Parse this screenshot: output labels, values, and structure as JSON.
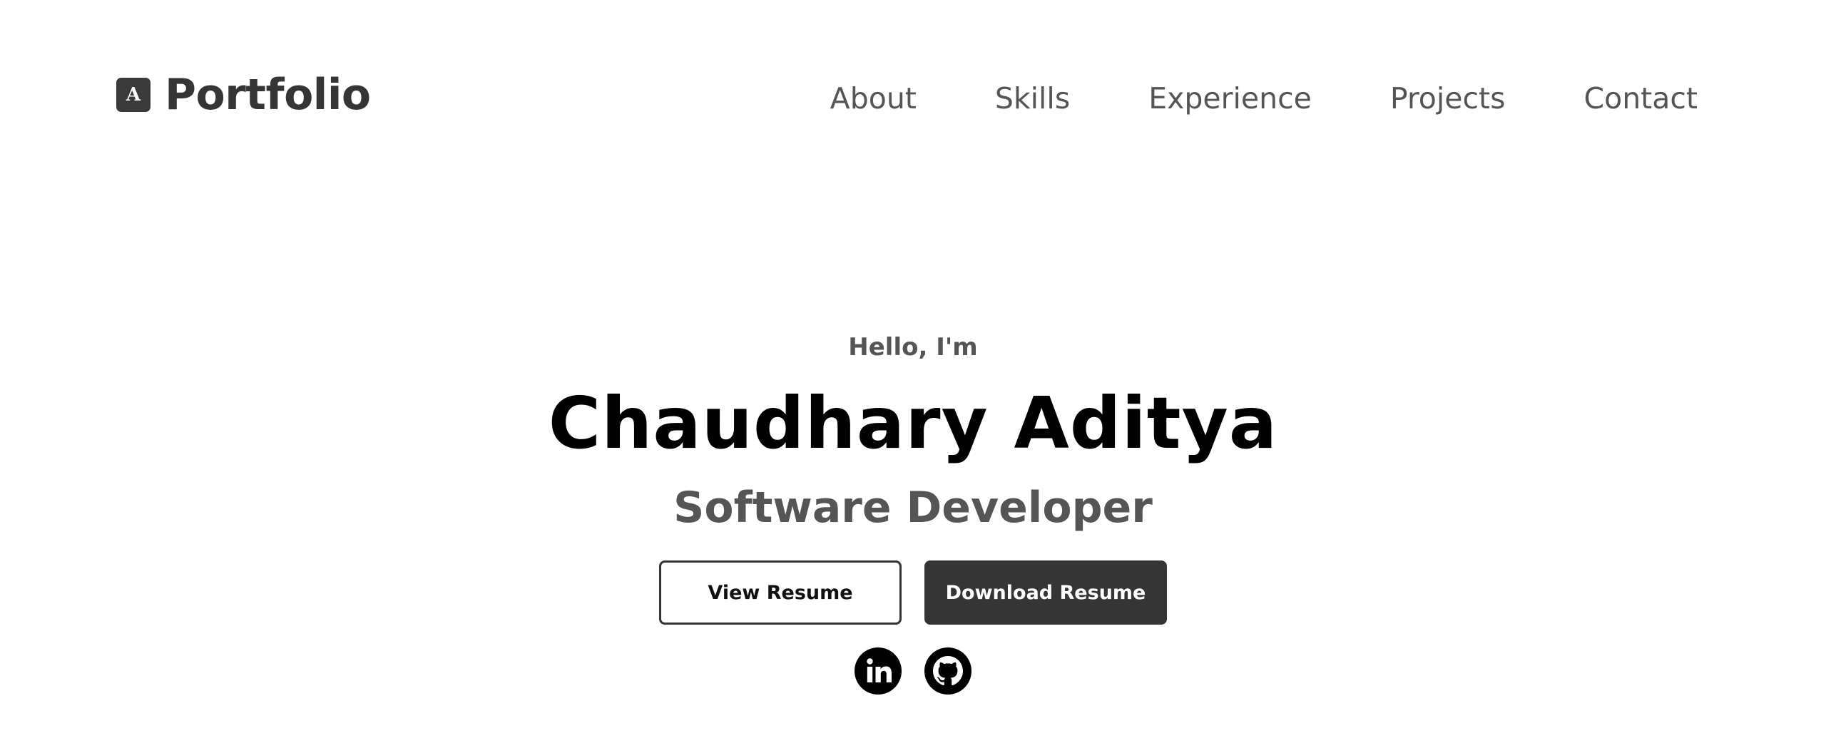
{
  "header": {
    "brand": {
      "logo_letter": "A",
      "name": "Portfolio"
    },
    "nav": [
      {
        "label": "About"
      },
      {
        "label": "Skills"
      },
      {
        "label": "Experience"
      },
      {
        "label": "Projects"
      },
      {
        "label": "Contact"
      }
    ]
  },
  "hero": {
    "greeting": "Hello, I'm",
    "name": "Chaudhary Aditya",
    "role": "Software Developer",
    "buttons": {
      "view_resume": "View Resume",
      "download_resume": "Download Resume"
    },
    "socials": [
      {
        "icon": "linkedin-icon"
      },
      {
        "icon": "github-icon"
      }
    ]
  },
  "colors": {
    "background": "#ffffff",
    "primary_dark": "#353535",
    "muted_text": "#555555",
    "heading": "#000000"
  }
}
